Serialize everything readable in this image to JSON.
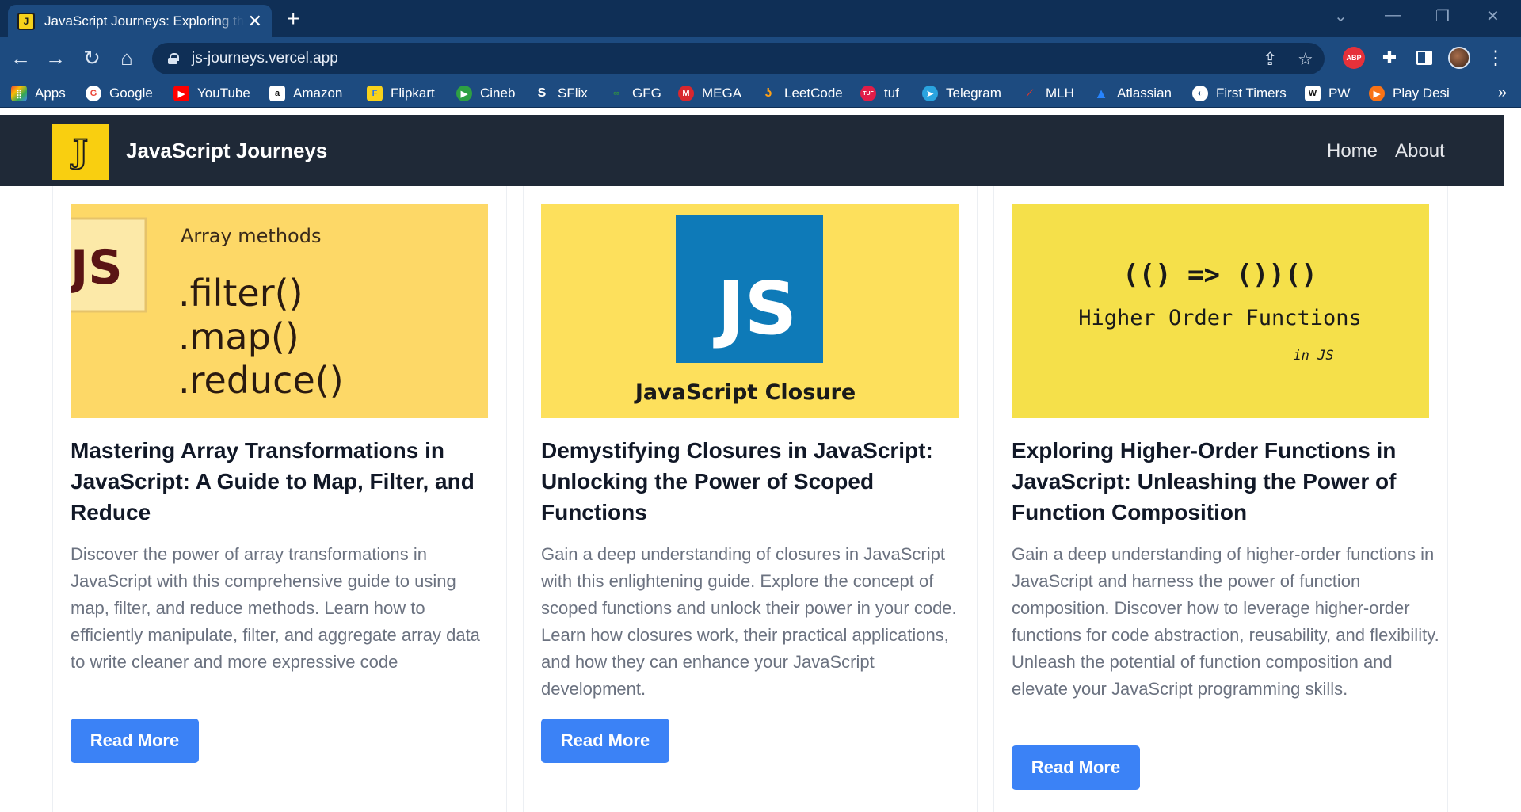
{
  "browser": {
    "tab_title": "JavaScript Journeys: Exploring the",
    "tab_favicon": "J",
    "url": "js-journeys.vercel.app",
    "bookmarks": [
      {
        "label": "Apps",
        "icon": "apps-grid-icon"
      },
      {
        "label": "Google",
        "icon": "google-icon"
      },
      {
        "label": "YouTube",
        "icon": "youtube-icon"
      },
      {
        "label": "Amazon",
        "icon": "amazon-icon"
      },
      {
        "label": "Flipkart",
        "icon": "flipkart-icon"
      },
      {
        "label": "Cineb",
        "icon": "cineb-icon"
      },
      {
        "label": "SFlix",
        "icon": "sflix-icon"
      },
      {
        "label": "GFG",
        "icon": "gfg-icon"
      },
      {
        "label": "MEGA",
        "icon": "mega-icon"
      },
      {
        "label": "LeetCode",
        "icon": "leetcode-icon"
      },
      {
        "label": "tuf",
        "icon": "tuf-icon"
      },
      {
        "label": "Telegram",
        "icon": "telegram-icon"
      },
      {
        "label": "MLH",
        "icon": "mlh-icon"
      },
      {
        "label": "Atlassian",
        "icon": "atlassian-icon"
      },
      {
        "label": "First Timers",
        "icon": "first-timers-icon"
      },
      {
        "label": "PW",
        "icon": "pw-icon"
      },
      {
        "label": "Play Desi",
        "icon": "play-desi-icon"
      }
    ],
    "extensions": {
      "abp": "ABP"
    }
  },
  "site": {
    "brand": "JavaScript Journeys",
    "logo_letter": "J",
    "nav": {
      "home": "Home",
      "about": "About"
    },
    "colors": {
      "header_bg": "#1f2937",
      "logo_bg": "#f9cf10",
      "button_bg": "#3b82f6"
    }
  },
  "cards": [
    {
      "image": {
        "badge": "JS",
        "heading": "Array methods",
        "lines": [
          ".filter()",
          ".map()",
          ".reduce()"
        ]
      },
      "title": "Mastering Array Transformations in JavaScript: A Guide to Map, Filter, and Reduce",
      "description": "Discover the power of array transformations in JavaScript with this comprehensive guide to using map, filter, and reduce methods. Learn how to efficiently manipulate, filter, and aggregate array data to write cleaner and more expressive code",
      "button": "Read More"
    },
    {
      "image": {
        "badge": "JS",
        "caption": "JavaScript Closure"
      },
      "title": "Demystifying Closures in JavaScript: Unlocking the Power of Scoped Functions",
      "description": "Gain a deep understanding of closures in JavaScript with this enlightening guide. Explore the concept of scoped functions and unlock their power in your code. Learn how closures work, their practical applications, and how they can enhance your JavaScript development.",
      "button": "Read More"
    },
    {
      "image": {
        "code": "(() => ())()",
        "heading": "Higher Order Functions",
        "sub": "in JS"
      },
      "title": "Exploring Higher-Order Functions in JavaScript: Unleashing the Power of Function Composition",
      "description": "Gain a deep understanding of higher-order functions in JavaScript and harness the power of function composition. Discover how to leverage higher-order functions for code abstraction, reusability, and flexibility. Unleash the potential of function composition and elevate your JavaScript programming skills.",
      "button": "Read More"
    }
  ]
}
